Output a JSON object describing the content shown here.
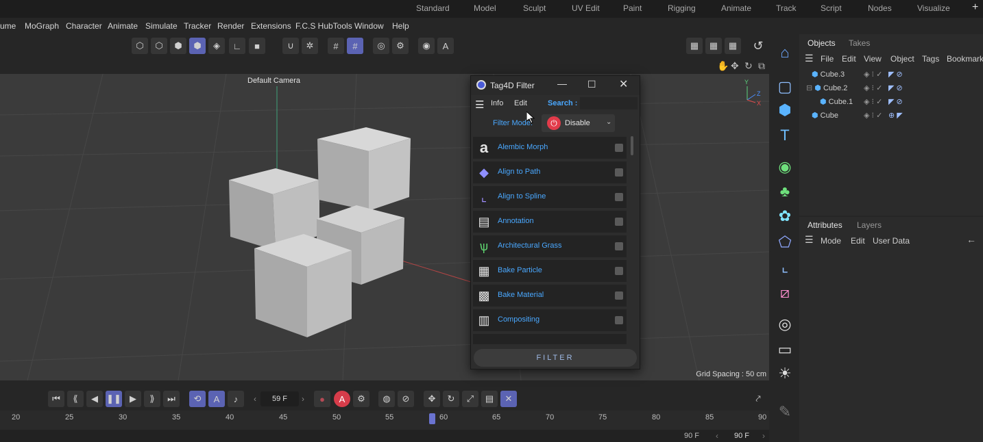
{
  "layout_tabs": [
    "Standard",
    "Model",
    "Sculpt",
    "UV Edit",
    "Paint",
    "Rigging",
    "Animate",
    "Track",
    "Script",
    "Nodes",
    "Visualize"
  ],
  "add_layout": "+",
  "menu": [
    "ume",
    "MoGraph",
    "Character",
    "Animate",
    "Simulate",
    "Tracker",
    "Render",
    "Extensions",
    "F.C.S HubTools",
    "Window",
    "Help"
  ],
  "viewport": {
    "camera": "Default Camera",
    "grid_spacing": "Grid Spacing : 50 cm"
  },
  "dialog": {
    "title": "Tag4D Filter",
    "menu_info": "Info",
    "menu_edit": "Edit",
    "search_label": "Search :",
    "search_value": "",
    "filter_mode_label": "Filter Mode:",
    "filter_mode_value": "Disable",
    "filter_button": "FILTER",
    "items": [
      {
        "label": "Alembic Morph",
        "icon": "alembic-icon"
      },
      {
        "label": "Align to Path",
        "icon": "align-path-icon"
      },
      {
        "label": "Align to Spline",
        "icon": "align-spline-icon"
      },
      {
        "label": "Annotation",
        "icon": "annotation-icon"
      },
      {
        "label": "Architectural Grass",
        "icon": "grass-icon"
      },
      {
        "label": "Bake Particle",
        "icon": "bake-particle-icon"
      },
      {
        "label": "Bake Material",
        "icon": "bake-material-icon"
      },
      {
        "label": "Compositing",
        "icon": "clapper-icon"
      }
    ]
  },
  "objects_panel": {
    "tabs": [
      "Objects",
      "Takes"
    ],
    "menu": [
      "File",
      "Edit",
      "View",
      "Object",
      "Tags",
      "Bookmarks"
    ],
    "items": [
      "Cube.3",
      "Cube.2",
      "Cube.1",
      "Cube"
    ]
  },
  "attributes_panel": {
    "tabs": [
      "Attributes",
      "Layers"
    ],
    "menu": [
      "Mode",
      "Edit",
      "User Data"
    ]
  },
  "timeline": {
    "current_frame": "59 F",
    "ruler": [
      "20",
      "25",
      "30",
      "35",
      "40",
      "45",
      "50",
      "55",
      "60",
      "65",
      "70",
      "75",
      "80",
      "85",
      "90"
    ],
    "end_frame": "90 F",
    "end_frame_field": "90 F"
  },
  "colors": {
    "accent": "#5b63b3",
    "link": "#4aa8ff",
    "power": "#e23b4a"
  }
}
